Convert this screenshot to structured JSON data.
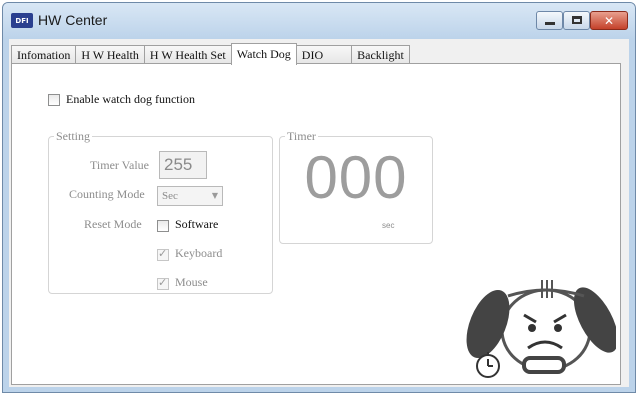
{
  "window": {
    "title": "HW Center",
    "logo_text": "DFI"
  },
  "tabs": [
    {
      "label": "Infomation",
      "active": false
    },
    {
      "label": "H W Health",
      "active": false
    },
    {
      "label": "H W Health Set",
      "active": false
    },
    {
      "label": "Watch Dog",
      "active": true
    },
    {
      "label": "DIO",
      "active": false
    },
    {
      "label": "Backlight",
      "active": false
    }
  ],
  "watchdog": {
    "enable_label": "Enable watch dog function",
    "enable_checked": false,
    "setting": {
      "group_title": "Setting",
      "timer_value_label": "Timer Value",
      "timer_value": "255",
      "counting_mode_label": "Counting Mode",
      "counting_mode_value": "Sec",
      "reset_mode_label": "Reset Mode",
      "reset_options": [
        {
          "label": "Software",
          "checked": false
        },
        {
          "label": "Keyboard",
          "checked": true
        },
        {
          "label": "Mouse",
          "checked": true
        }
      ]
    },
    "timer": {
      "group_title": "Timer",
      "display": "000",
      "unit": "sec"
    }
  },
  "icons": [
    "dfi-logo-icon",
    "minimize-icon",
    "maximize-icon",
    "close-icon",
    "watchdog-mascot-icon",
    "stopwatch-icon"
  ]
}
